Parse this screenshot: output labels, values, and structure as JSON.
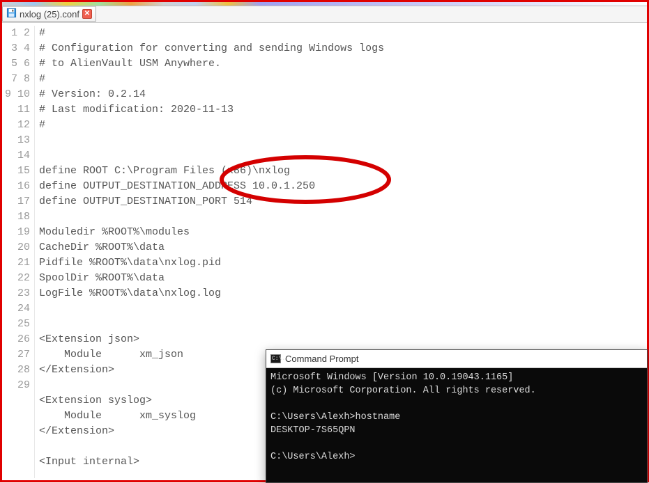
{
  "tab": {
    "filename": "nxlog (25).conf"
  },
  "code_lines": [
    "#",
    "# Configuration for converting and sending Windows logs",
    "# to AlienVault USM Anywhere.",
    "#",
    "# Version: 0.2.14",
    "# Last modification: 2020-11-13",
    "#",
    "",
    "",
    "define ROOT C:\\Program Files (x86)\\nxlog",
    "define OUTPUT_DESTINATION_ADDRESS 10.0.1.250",
    "define OUTPUT_DESTINATION_PORT 514",
    "",
    "Moduledir %ROOT%\\modules",
    "CacheDir %ROOT%\\data",
    "Pidfile %ROOT%\\data\\nxlog.pid",
    "SpoolDir %ROOT%\\data",
    "LogFile %ROOT%\\data\\nxlog.log",
    "",
    "",
    "<Extension json>",
    "    Module      xm_json",
    "</Extension>",
    "",
    "<Extension syslog>",
    "    Module      xm_syslog",
    "</Extension>",
    "",
    "<Input internal>"
  ],
  "gutter_start": 1,
  "cmd": {
    "title": "Command Prompt",
    "icon_label": "C:\\.",
    "lines": [
      "Microsoft Windows [Version 10.0.19043.1165]",
      "(c) Microsoft Corporation. All rights reserved.",
      "",
      "C:\\Users\\Alexh>hostname",
      "DESKTOP-7S65QPN",
      "",
      "C:\\Users\\Alexh>"
    ]
  }
}
